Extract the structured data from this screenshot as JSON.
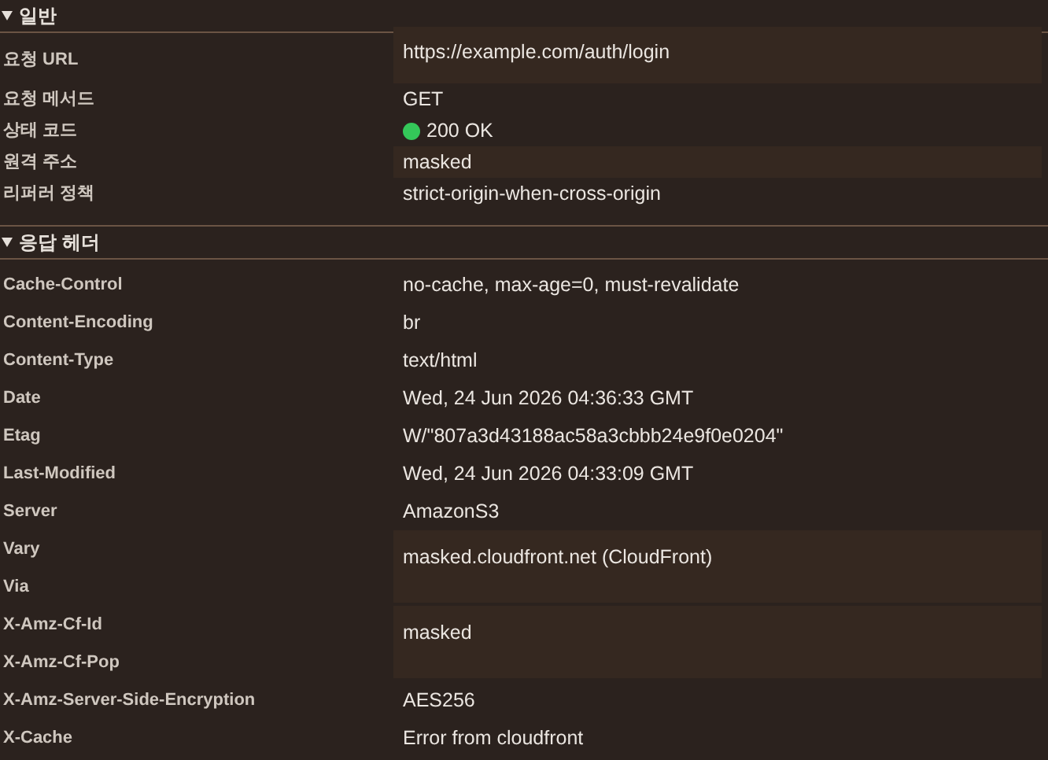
{
  "sections": [
    {
      "title": "일반",
      "expanded": true,
      "groups": [
        {
          "names": [
            "요청 URL"
          ],
          "value": "https://example.com/auth/login",
          "masked": true
        },
        {
          "names": [
            "요청 메서드"
          ],
          "value": "GET",
          "masked": false
        },
        {
          "names": [
            "상태 코드"
          ],
          "value": "200 OK",
          "masked": false,
          "color": "#34c759"
        },
        {
          "names": [
            "원격 주소"
          ],
          "value": "masked",
          "masked": true
        },
        {
          "names": [
            "리퍼러 정책"
          ],
          "value": "strict-origin-when-cross-origin",
          "masked": false
        }
      ]
    },
    {
      "title": "응답 헤더",
      "expanded": true,
      "groups": [
        {
          "names": [
            "Cache-Control"
          ],
          "value": "no-cache, max-age=0, must-revalidate",
          "masked": false
        },
        {
          "names": [
            "Content-Encoding"
          ],
          "value": "br",
          "masked": false
        },
        {
          "names": [
            "Content-Type"
          ],
          "value": "text/html",
          "masked": false
        },
        {
          "names": [
            "Date"
          ],
          "value": "Wed, 24 Jun 2026 04:36:33 GMT",
          "masked": false
        },
        {
          "names": [
            "Etag"
          ],
          "value": "W/\"807a3d43188ac58a3cbbb24e9f0e0204\"",
          "masked": false
        },
        {
          "names": [
            "Last-Modified"
          ],
          "value": "Wed, 24 Jun 2026 04:33:09 GMT",
          "masked": false
        },
        {
          "names": [
            "Server"
          ],
          "value": "AmazonS3",
          "masked": false
        },
        {
          "names": [
            "Vary",
            "Via"
          ],
          "value": "masked.cloudfront.net (CloudFront)",
          "masked": true
        },
        {
          "names": [
            "X-Amz-Cf-Id",
            "X-Amz-Cf-Pop"
          ],
          "value": "masked",
          "masked": true
        },
        {
          "names": [
            "X-Amz-Server-Side-Encryption"
          ],
          "value": "AES256",
          "masked": false
        },
        {
          "names": [
            "X-Cache"
          ],
          "value": "Error from cloudfront",
          "masked": false
        }
      ]
    }
  ]
}
